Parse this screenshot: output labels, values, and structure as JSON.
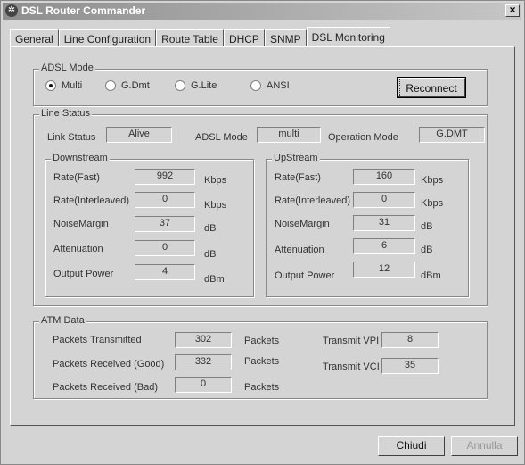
{
  "window": {
    "title": "DSL Router Commander",
    "app_icon": "satellite-icon",
    "close_label": "×"
  },
  "tabs": [
    {
      "label": "General"
    },
    {
      "label": "Line Configuration"
    },
    {
      "label": "Route Table"
    },
    {
      "label": "DHCP"
    },
    {
      "label": "SNMP"
    },
    {
      "label": "DSL Monitoring",
      "active": true
    }
  ],
  "adsl_mode": {
    "legend": "ADSL Mode",
    "options": [
      {
        "label": "Multi",
        "selected": true
      },
      {
        "label": "G.Dmt",
        "selected": false
      },
      {
        "label": "G.Lite",
        "selected": false
      },
      {
        "label": "ANSI",
        "selected": false
      }
    ],
    "reconnect_label": "Reconnect"
  },
  "line_status": {
    "legend": "Line Status",
    "link_status_label": "Link Status",
    "link_status_value": "Alive",
    "adsl_mode_label": "ADSL Mode",
    "adsl_mode_value": "multi",
    "operation_mode_label": "Operation Mode",
    "operation_mode_value": "G.DMT",
    "downstream": {
      "legend": "Downstream",
      "rows": [
        {
          "label": "Rate(Fast)",
          "value": "992",
          "unit": "Kbps"
        },
        {
          "label": "Rate(Interleaved)",
          "value": "0",
          "unit": "Kbps"
        },
        {
          "label": "NoiseMargin",
          "value": "37",
          "unit": "dB"
        },
        {
          "label": "Attenuation",
          "value": "0",
          "unit": "dB"
        },
        {
          "label": "Output Power",
          "value": "4",
          "unit": "dBm"
        }
      ]
    },
    "upstream": {
      "legend": "UpStream",
      "rows": [
        {
          "label": "Rate(Fast)",
          "value": "160",
          "unit": "Kbps"
        },
        {
          "label": "Rate(Interleaved)",
          "value": "0",
          "unit": "Kbps"
        },
        {
          "label": "NoiseMargin",
          "value": "31",
          "unit": "dB"
        },
        {
          "label": "Attenuation",
          "value": "6",
          "unit": "dB"
        },
        {
          "label": "Output Power",
          "value": "12",
          "unit": "dBm"
        }
      ]
    }
  },
  "atm_data": {
    "legend": "ATM Data",
    "rows": [
      {
        "label": "Packets Transmitted",
        "value": "302",
        "unit": "Packets"
      },
      {
        "label": "Packets Received (Good)",
        "value": "332",
        "unit": "Packets"
      },
      {
        "label": "Packets Received (Bad)",
        "value": "0",
        "unit": "Packets"
      }
    ],
    "vpi_label": "Transmit VPI",
    "vpi_value": "8",
    "vci_label": "Transmit VCI",
    "vci_value": "35"
  },
  "footer": {
    "ok_label": "Chiudi",
    "cancel_label": "Annulla"
  }
}
